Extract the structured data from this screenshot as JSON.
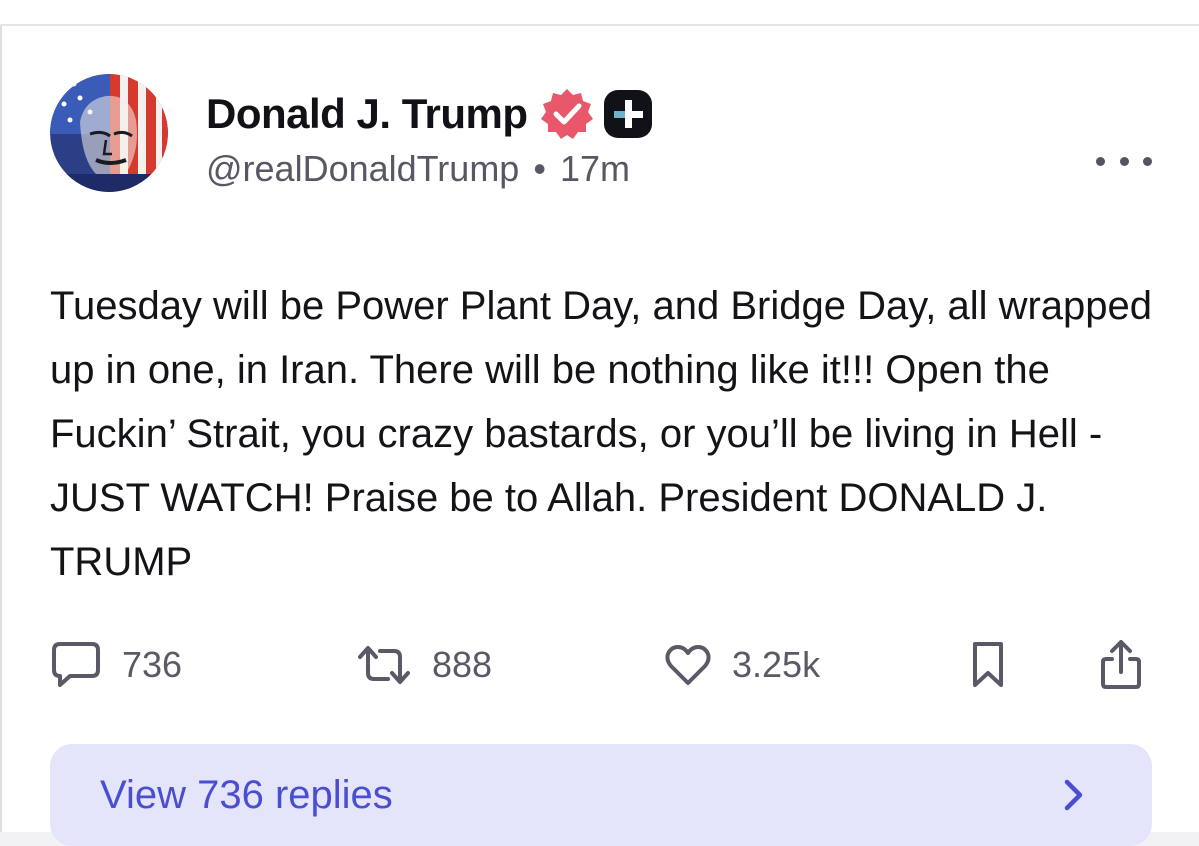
{
  "post": {
    "author": {
      "display_name": "Donald J. Trump",
      "handle": "@realDonaldTrump",
      "verified": true
    },
    "separator": "•",
    "time_ago": "17m",
    "body": "Tuesday will be Power Plant Day, and Bridge Day, all wrapped up in one, in Iran. There will be nothing like it!!! Open the Fuckin’ Strait, you crazy bastards, or you’ll be living in Hell - JUST WATCH! Praise be to Allah. President DONALD J. TRUMP",
    "stats": {
      "replies": "736",
      "reposts": "888",
      "likes": "3.25k"
    },
    "view_replies_label": "View 736 replies"
  },
  "icons": {
    "verified": "verified-badge-icon",
    "plus": "plus-badge-icon",
    "more": "more-dots-icon",
    "reply": "comment-icon",
    "repost": "repost-icon",
    "like": "heart-icon",
    "bookmark": "bookmark-icon",
    "share": "share-icon",
    "chevron": "chevron-right-icon"
  },
  "colors": {
    "verified_badge": "#e8586a",
    "accent": "#4a4fd1",
    "replies_bar_bg": "#e4e5fb",
    "text_primary": "#131318",
    "text_secondary": "#5a5a66"
  }
}
